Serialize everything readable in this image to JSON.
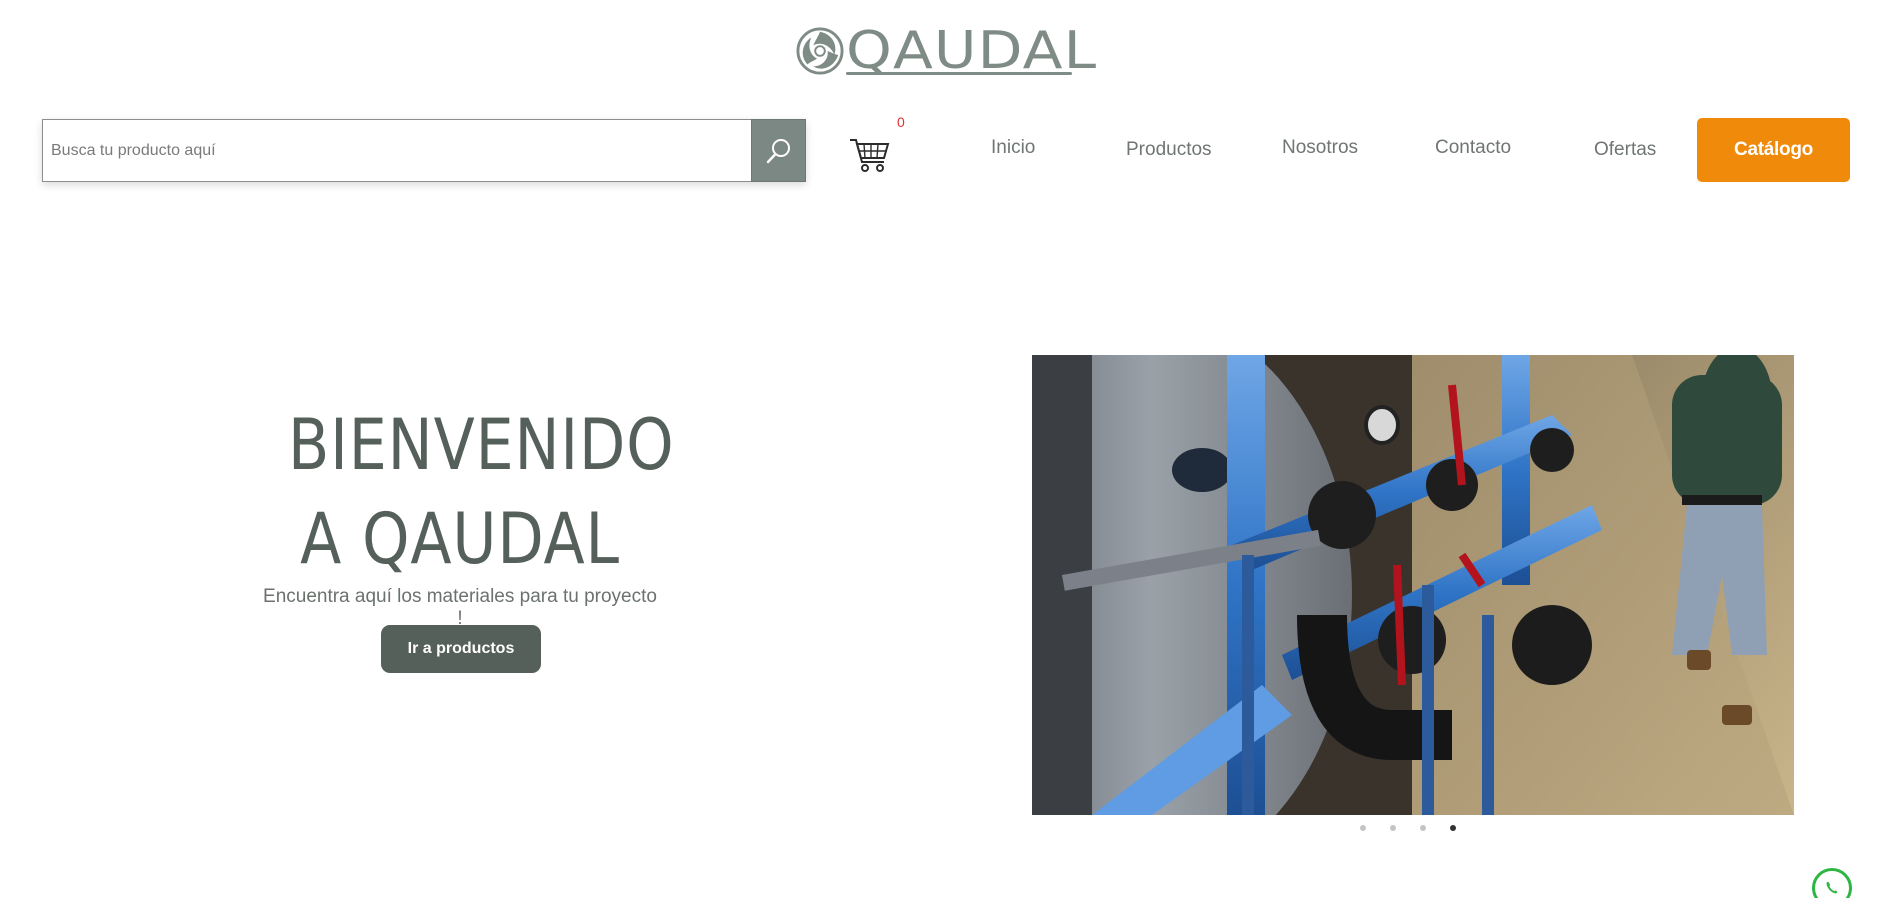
{
  "brand": {
    "name": "QAUDAL",
    "logo_color": "#7f8c86"
  },
  "search": {
    "placeholder": "Busca tu producto aquí",
    "button_icon": "search-icon"
  },
  "cart": {
    "icon": "cart-icon",
    "count": "0"
  },
  "nav": {
    "items": [
      {
        "label": "Inicio"
      },
      {
        "label": "Productos"
      },
      {
        "label": "Nosotros"
      },
      {
        "label": "Contacto"
      },
      {
        "label": "Ofertas"
      }
    ],
    "catalog_label": "Catálogo",
    "catalog_color": "#ef8a0b"
  },
  "hero": {
    "title_line1": "BIENVENIDO",
    "title_line2": "A QAUDAL",
    "subtitle": "Encuentra aquí los materiales para tu proyecto !",
    "button_label": "Ir a productos",
    "button_color": "#56605b"
  },
  "slider": {
    "slide_count": 4,
    "active_index": 3
  },
  "whatsapp": {
    "icon": "whatsapp-icon",
    "color": "#2db742"
  }
}
